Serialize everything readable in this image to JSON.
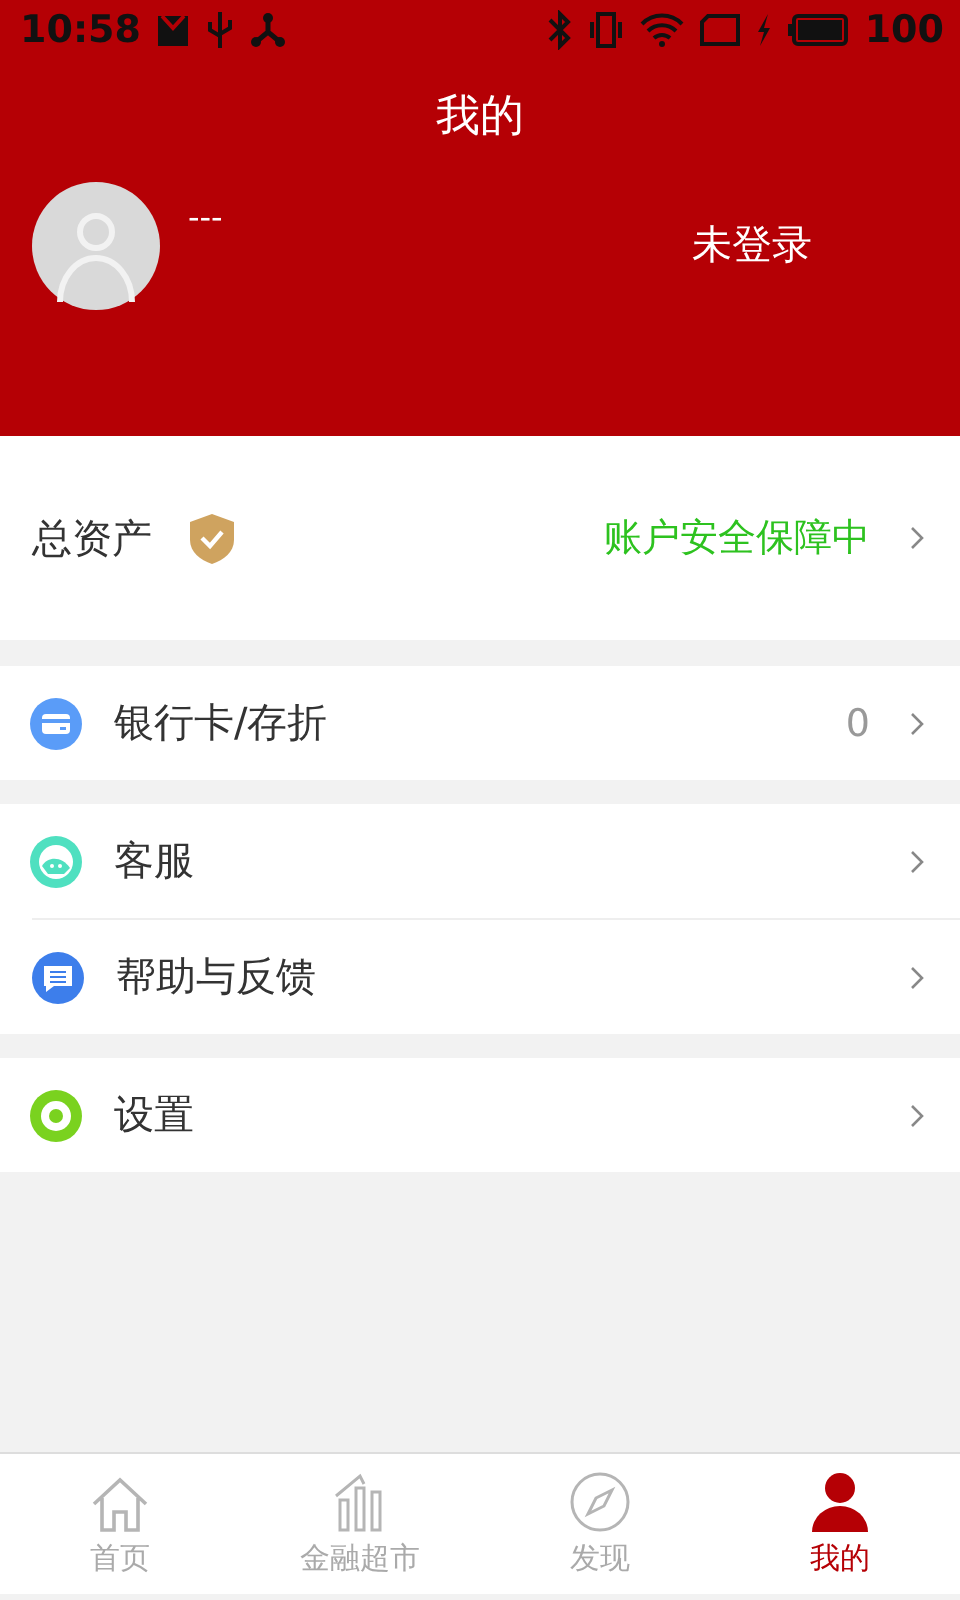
{
  "status_bar": {
    "time": "10:58",
    "battery": "100"
  },
  "header": {
    "title": "我的",
    "user_name": "---",
    "login_status": "未登录"
  },
  "assets": {
    "label": "总资产",
    "security": "账户安全保障中"
  },
  "menu_groups": [
    {
      "items": [
        {
          "kind": "card",
          "label": "银行卡/存折",
          "value": "0"
        }
      ]
    },
    {
      "items": [
        {
          "kind": "service",
          "label": "客服"
        },
        {
          "kind": "help",
          "label": "帮助与反馈"
        }
      ]
    },
    {
      "items": [
        {
          "kind": "settings",
          "label": "设置"
        }
      ]
    }
  ],
  "tabs": [
    {
      "kind": "home",
      "label": "首页",
      "selected": false
    },
    {
      "kind": "market",
      "label": "金融超市",
      "selected": false
    },
    {
      "kind": "discover",
      "label": "发现",
      "selected": false
    },
    {
      "kind": "me",
      "label": "我的",
      "selected": true
    }
  ]
}
